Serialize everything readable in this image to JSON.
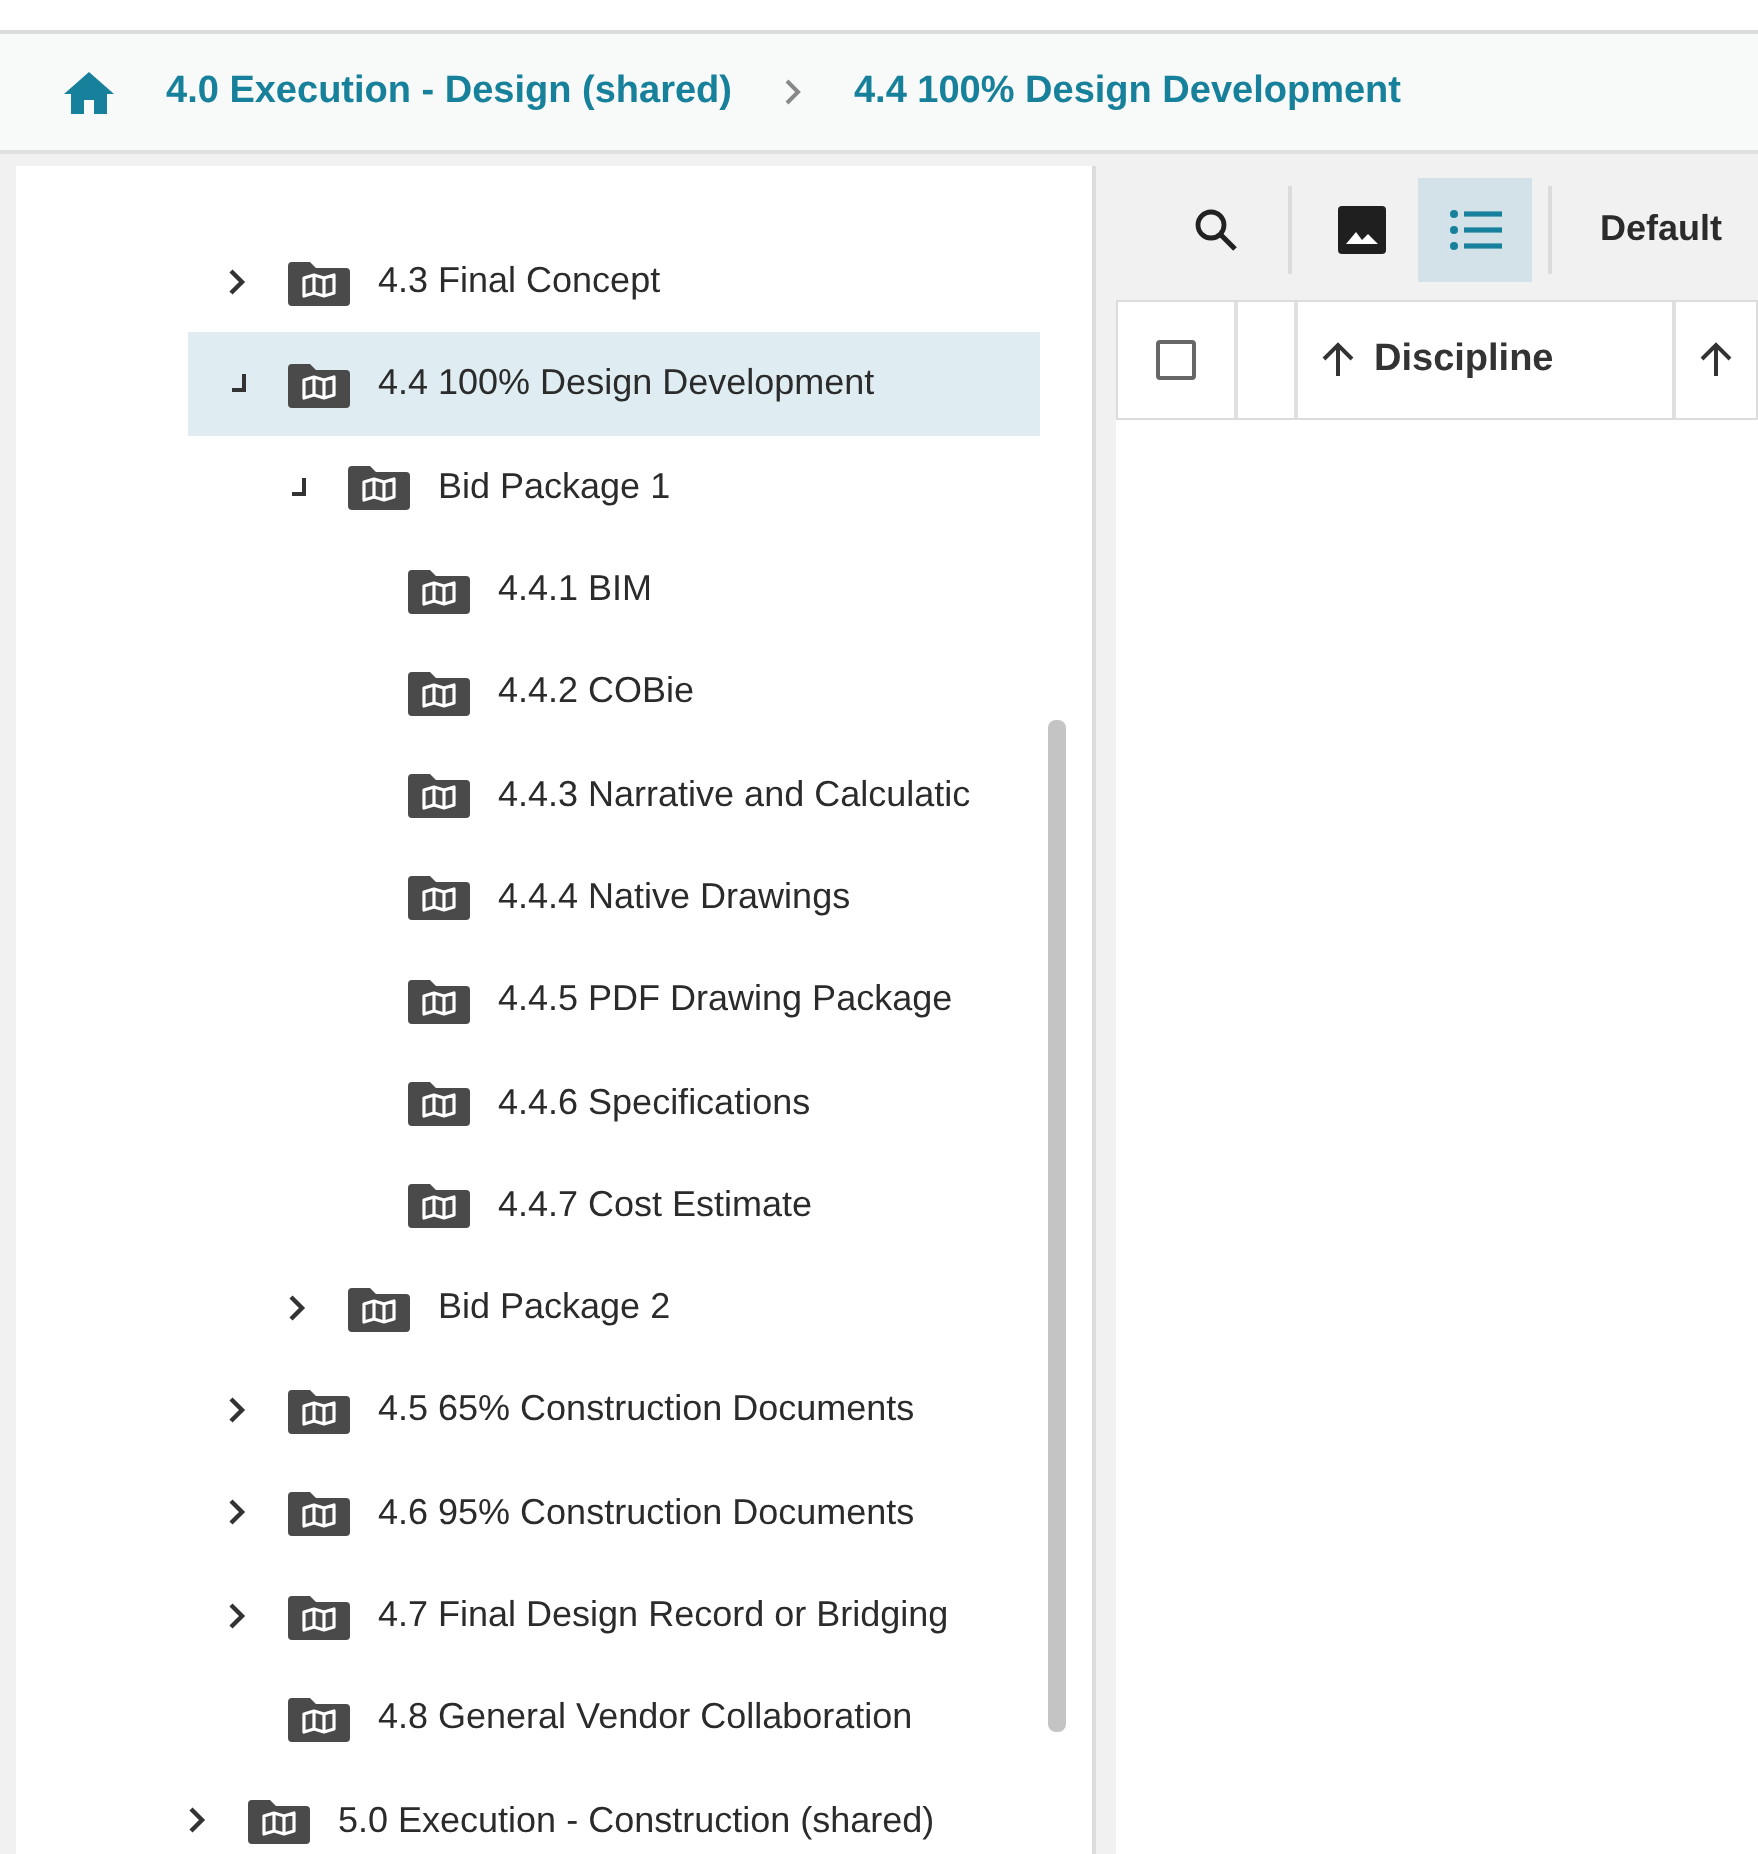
{
  "breadcrumb": {
    "items": [
      {
        "label": "4.0 Execution - Design (shared)"
      },
      {
        "label": "4.4 100% Design Development"
      }
    ]
  },
  "tree": {
    "items": [
      {
        "label": "4.3 Final Concept",
        "expanded": false,
        "selected": false
      },
      {
        "label": "4.4 100% Design Development",
        "expanded": true,
        "selected": true,
        "children": [
          {
            "label": "Bid Package 1",
            "expanded": true,
            "selected": false,
            "children": [
              {
                "label": "4.4.1 BIM",
                "selected": false
              },
              {
                "label": "4.4.2 COBie",
                "selected": false
              },
              {
                "label": "4.4.3 Narrative and Calculatic",
                "selected": false
              },
              {
                "label": "4.4.4 Native Drawings",
                "selected": false
              },
              {
                "label": "4.4.5 PDF Drawing Package",
                "selected": false
              },
              {
                "label": "4.4.6 Specifications",
                "selected": false
              },
              {
                "label": "4.4.7 Cost Estimate",
                "selected": false
              }
            ]
          },
          {
            "label": "Bid Package 2",
            "expanded": false,
            "selected": false
          }
        ]
      },
      {
        "label": "4.5 65% Construction Documents",
        "expanded": false,
        "selected": false
      },
      {
        "label": "4.6 95% Construction Documents",
        "expanded": false,
        "selected": false
      },
      {
        "label": "4.7 Final Design Record or Bridging",
        "expanded": false,
        "selected": false
      },
      {
        "label": "4.8 General Vendor Collaboration",
        "selected": false
      }
    ],
    "parent_siblings": [
      {
        "label": "5.0 Execution - Construction (shared)",
        "expanded": false,
        "selected": false
      }
    ]
  },
  "toolbar": {
    "views": [
      {
        "kind": "image",
        "selected": false
      },
      {
        "kind": "list",
        "selected": true
      }
    ],
    "layout": "Default"
  },
  "table": {
    "columns": [
      {
        "kind": "checkbox",
        "checked": false
      },
      {
        "kind": "empty"
      },
      {
        "kind": "sort",
        "label": "Discipline"
      },
      {
        "kind": "sort"
      }
    ]
  }
}
